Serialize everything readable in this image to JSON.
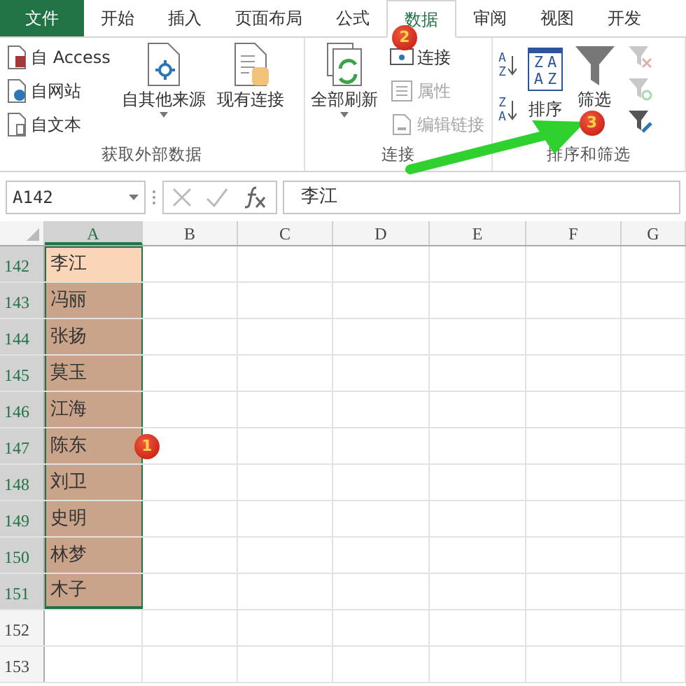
{
  "tabs": [
    {
      "label": "文件",
      "kind": "file",
      "selected": false
    },
    {
      "label": "开始",
      "kind": "tab",
      "selected": false
    },
    {
      "label": "插入",
      "kind": "tab",
      "selected": false
    },
    {
      "label": "页面布局",
      "kind": "tab",
      "selected": false
    },
    {
      "label": "公式",
      "kind": "tab",
      "selected": false
    },
    {
      "label": "数据",
      "kind": "tab",
      "selected": true
    },
    {
      "label": "审阅",
      "kind": "tab",
      "selected": false
    },
    {
      "label": "视图",
      "kind": "tab",
      "selected": false
    },
    {
      "label": "开发",
      "kind": "tab",
      "selected": false
    }
  ],
  "ribbon": {
    "groups": [
      {
        "label": "获取外部数据",
        "items": [
          {
            "kind": "stack",
            "buttons": [
              {
                "label": "自 Access",
                "disabled": false
              },
              {
                "label": "自网站",
                "disabled": false
              },
              {
                "label": "自文本",
                "disabled": false
              }
            ]
          },
          {
            "kind": "large",
            "label": "自其他来源",
            "dropdown": true,
            "disabled": false
          },
          {
            "kind": "large",
            "label": "现有连接",
            "disabled": false
          }
        ]
      },
      {
        "label": "连接",
        "items": [
          {
            "kind": "large",
            "label": "全部刷新",
            "dropdown": true,
            "disabled": false
          },
          {
            "kind": "stack",
            "buttons": [
              {
                "label": "连接",
                "disabled": false,
                "marker": "2"
              },
              {
                "label": "属性",
                "disabled": true
              },
              {
                "label": "编辑链接",
                "disabled": true
              }
            ]
          }
        ]
      },
      {
        "label": "排序和筛选",
        "items": [
          {
            "kind": "sortstack",
            "buttons": [
              {
                "glyphs": [
                  "A",
                  "Z"
                ]
              },
              {
                "glyphs": [
                  "Z",
                  "A"
                ]
              }
            ]
          },
          {
            "kind": "large",
            "label": "排序",
            "glyphs": [
              "Z",
              "A",
              "A",
              "Z"
            ],
            "disabled": false
          },
          {
            "kind": "large",
            "label": "筛选",
            "disabled": false,
            "marker": "3"
          },
          {
            "kind": "iconstack",
            "buttons": [
              {
                "disabled": true
              },
              {
                "disabled": true
              },
              {
                "disabled": false
              }
            ]
          }
        ]
      }
    ]
  },
  "name_box": "A142",
  "formula": "李江",
  "columns": [
    {
      "label": "A",
      "selected": true
    },
    {
      "label": "B",
      "selected": false
    },
    {
      "label": "C",
      "selected": false
    },
    {
      "label": "D",
      "selected": false
    },
    {
      "label": "E",
      "selected": false
    },
    {
      "label": "F",
      "selected": false
    },
    {
      "label": "G",
      "selected": false
    }
  ],
  "rows": [
    {
      "number": "142",
      "value": "李江",
      "selected": true,
      "active": true
    },
    {
      "number": "143",
      "value": "冯丽",
      "selected": true,
      "active": false
    },
    {
      "number": "144",
      "value": "张扬",
      "selected": true,
      "active": false
    },
    {
      "number": "145",
      "value": "莫玉",
      "selected": true,
      "active": false
    },
    {
      "number": "146",
      "value": "江海",
      "selected": true,
      "active": false
    },
    {
      "number": "147",
      "value": "陈东",
      "selected": true,
      "active": false,
      "marker": "1"
    },
    {
      "number": "148",
      "value": "刘卫",
      "selected": true,
      "active": false
    },
    {
      "number": "149",
      "value": "史明",
      "selected": true,
      "active": false
    },
    {
      "number": "150",
      "value": "林梦",
      "selected": true,
      "active": false
    },
    {
      "number": "151",
      "value": "木子",
      "selected": true,
      "active": false
    },
    {
      "number": "152",
      "selected": false,
      "active": false
    },
    {
      "number": "153",
      "selected": false,
      "active": false
    }
  ]
}
